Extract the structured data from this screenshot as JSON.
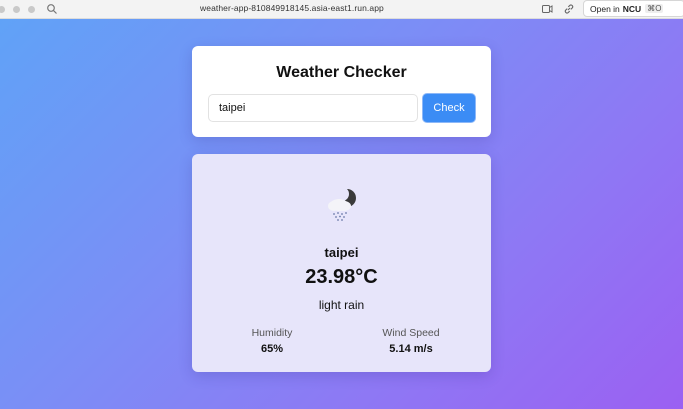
{
  "browser": {
    "url": "weather-app-810849918145.asia-east1.run.app",
    "open_in_label": "Open in",
    "open_in_target": "NCU",
    "shortcut": "⌘O"
  },
  "app": {
    "title": "Weather Checker",
    "search": {
      "value": "taipei",
      "button_label": "Check"
    },
    "result": {
      "icon": "night-cloud-rain-icon",
      "city": "taipei",
      "temperature": "23.98°C",
      "description": "light rain",
      "humidity_label": "Humidity",
      "humidity_value": "65%",
      "wind_label": "Wind Speed",
      "wind_value": "5.14 m/s"
    }
  },
  "colors": {
    "gradient_start": "#5fa3f7",
    "gradient_end": "#9b60f2",
    "accent_button": "#3b8cf5",
    "result_card_bg": "#e7e5fa"
  }
}
